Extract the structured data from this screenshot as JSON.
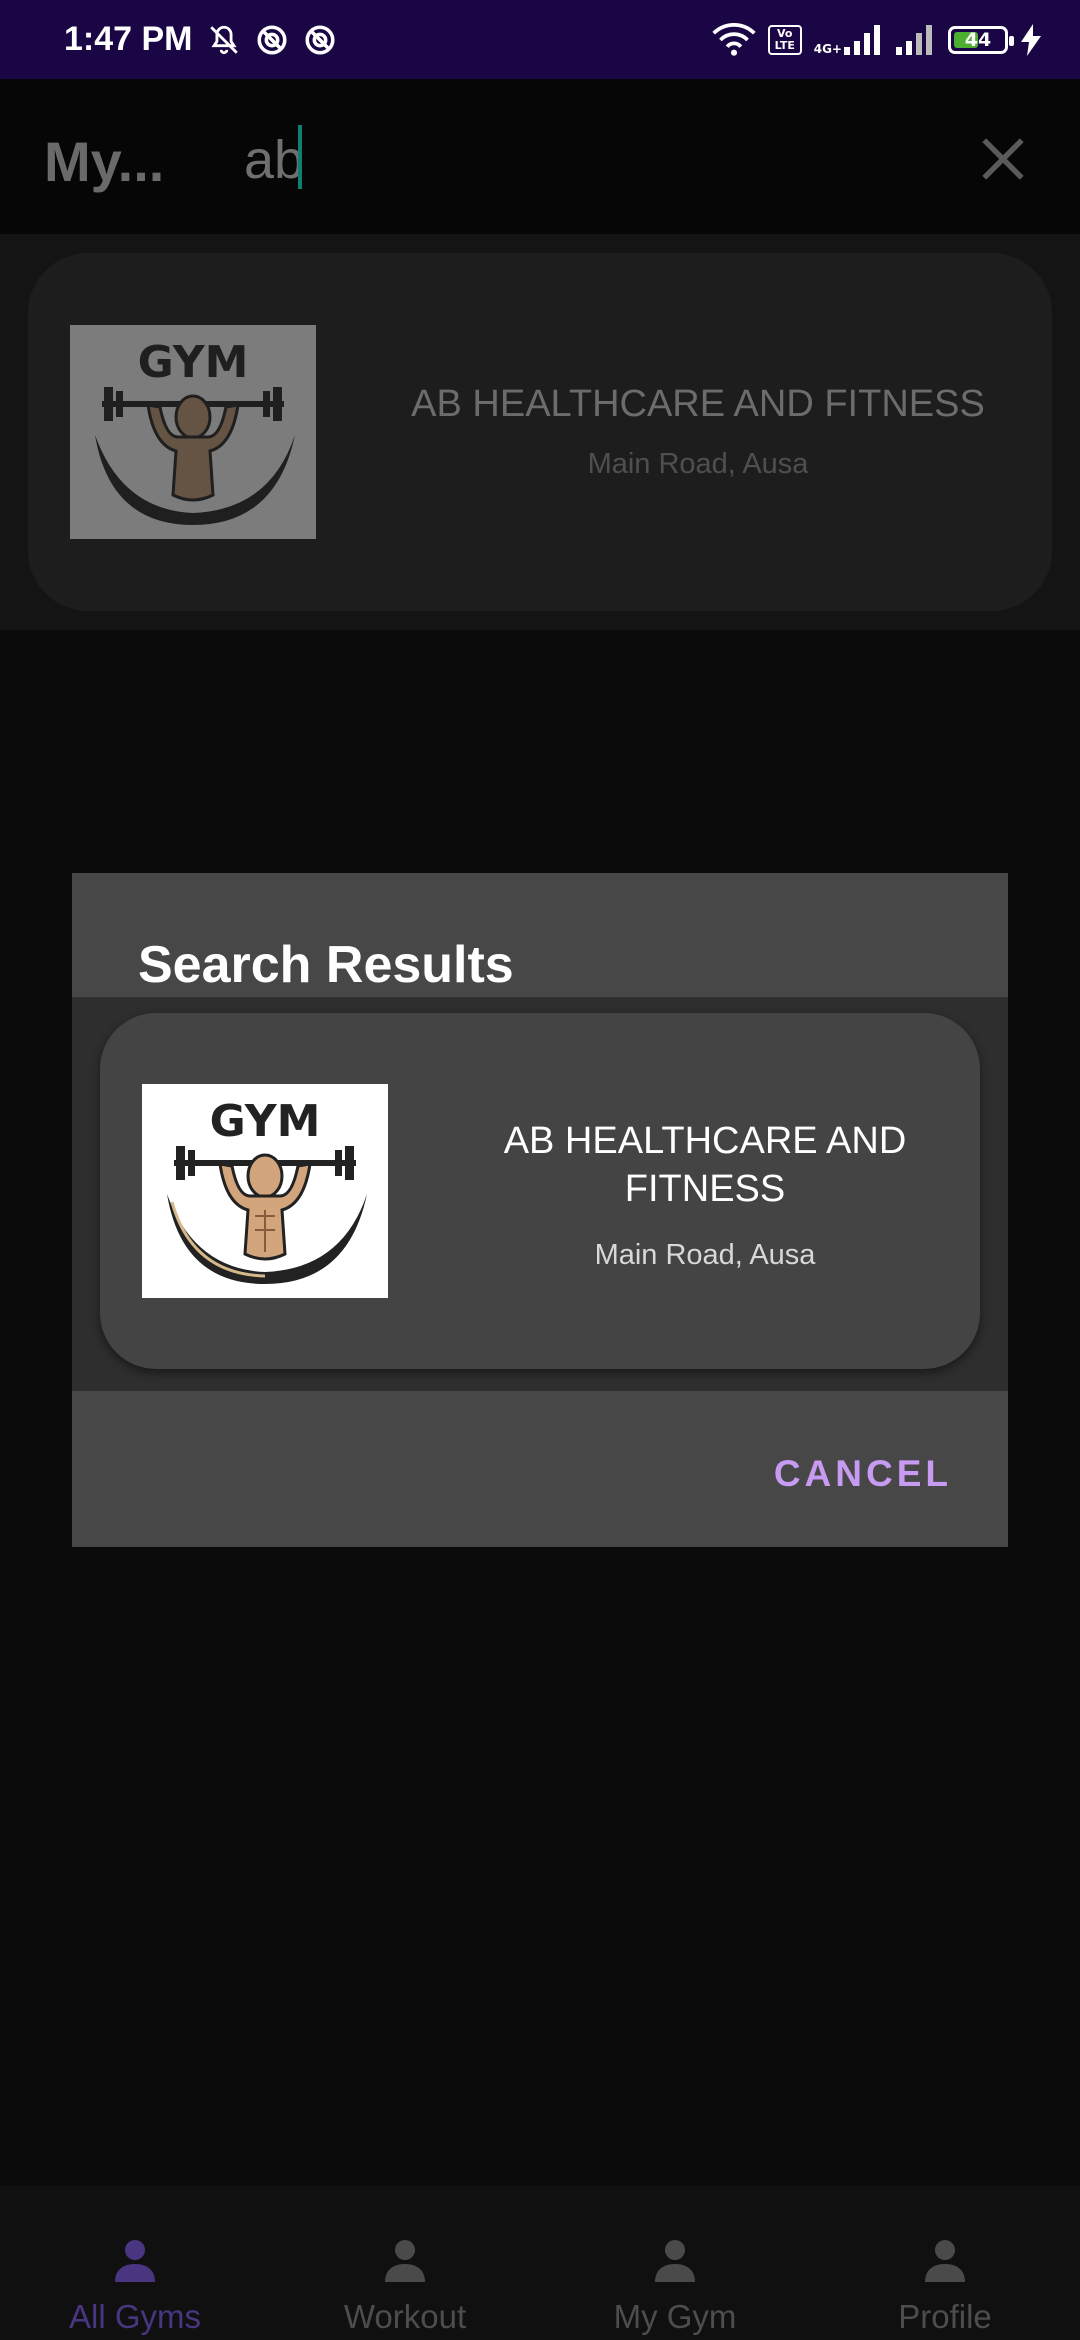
{
  "status_bar": {
    "time": "1:47 PM",
    "network_label": "4G+",
    "volte_label": "Vo LTE",
    "battery_level": "44",
    "icons": [
      "mute-bell-icon",
      "data-saver-icon",
      "data-saver-icon",
      "wifi-icon",
      "volte-icon",
      "signal-icon",
      "signal-icon",
      "battery-icon",
      "charging-icon"
    ]
  },
  "toolbar": {
    "title": "My...",
    "search_value": "ab",
    "close_icon": "close-icon"
  },
  "background_result": {
    "name": "AB HEALTHCARE AND FITNESS",
    "address": "Main Road, Ausa",
    "logo_text": "GYM"
  },
  "dialog": {
    "title": "Search Results",
    "results": [
      {
        "name": "AB HEALTHCARE AND FITNESS",
        "address": "Main Road, Ausa",
        "logo_text": "GYM"
      }
    ],
    "cancel_label": "CANCEL"
  },
  "bottom_nav": {
    "items": [
      {
        "label": "All Gyms",
        "icon": "person-icon",
        "active": true
      },
      {
        "label": "Workout",
        "icon": "person-icon",
        "active": false
      },
      {
        "label": "My Gym",
        "icon": "person-icon",
        "active": false
      },
      {
        "label": "Profile",
        "icon": "person-icon",
        "active": false
      }
    ]
  },
  "colors": {
    "status_bar": "#1a0645",
    "accent": "#c79bf2",
    "active_nav": "#4a3580",
    "cursor": "#117e74"
  }
}
